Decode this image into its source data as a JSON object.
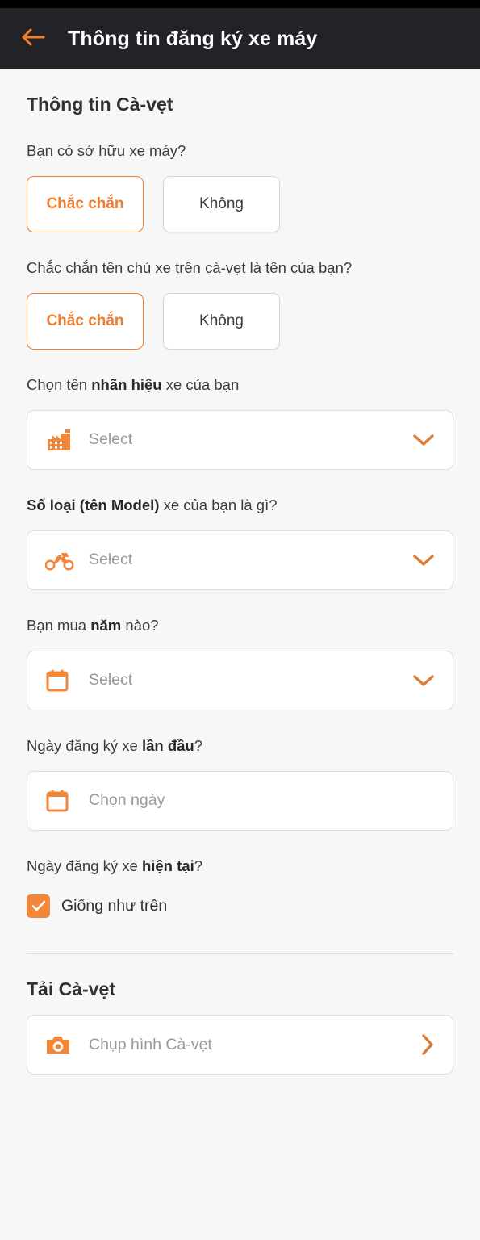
{
  "header": {
    "back_icon": "arrow-left-icon",
    "title": "Thông tin đăng ký xe máy"
  },
  "main": {
    "section_title": "Thông tin Cà-vẹt",
    "question_own": {
      "label": "Bạn có sở hữu xe máy?",
      "options": [
        "Chắc chắn",
        "Không"
      ],
      "selected": "Chắc chắn"
    },
    "question_owner_name": {
      "label": "Chắc chắn tên chủ xe trên cà-vẹt là tên của bạn?",
      "options": [
        "Chắc chắn",
        "Không"
      ],
      "selected": "Chắc chắn"
    },
    "brand": {
      "label_pre": "Chọn tên ",
      "label_bold": "nhãn hiệu",
      "label_post": " xe của bạn",
      "icon": "factory-icon",
      "placeholder": "Select",
      "value": "Select",
      "chevron": "chevron-down-icon"
    },
    "model": {
      "label_pre": "",
      "label_bold": "Số loại (tên Model)",
      "label_post": " xe của bạn là gì?",
      "icon": "motorcycle-icon",
      "placeholder": "Select",
      "value": "Select",
      "chevron": "chevron-down-icon"
    },
    "year": {
      "label_pre": "Bạn mua ",
      "label_bold": "năm",
      "label_post": " nào?",
      "icon": "calendar-icon",
      "placeholder": "Select",
      "value": "Select",
      "chevron": "chevron-down-icon"
    },
    "first_registration": {
      "label_pre": "Ngày đăng ký xe ",
      "label_bold": "lần đầu",
      "label_post": "?",
      "icon": "calendar-icon",
      "placeholder": "Chọn ngày",
      "value": "Chọn ngày"
    },
    "current_registration": {
      "label_pre": "Ngày đăng ký xe ",
      "label_bold": "hiện tại",
      "label_post": "?",
      "checkbox_label": "Giống như trên",
      "checked": true
    },
    "upload": {
      "title": "Tải Cà-vẹt",
      "icon": "camera-icon",
      "placeholder": "Chụp hình Cà-vẹt",
      "value": "Chụp hình Cà-vẹt",
      "chevron": "chevron-right-icon"
    }
  },
  "colors": {
    "accent": "#ef7d2e",
    "header_bg": "#232327",
    "page_bg": "#f7f7f8",
    "text": "#3a3c40",
    "placeholder": "#9a9a9e"
  }
}
